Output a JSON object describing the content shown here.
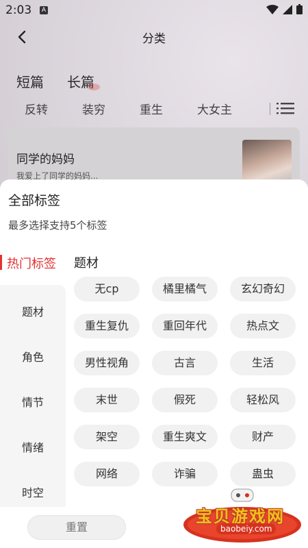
{
  "status_bar": {
    "time": "2:03",
    "app_icon_letter": "A"
  },
  "header": {
    "title": "分类"
  },
  "main_tabs": [
    {
      "label": "短篇"
    },
    {
      "label": "长篇"
    }
  ],
  "sub_tabs": [
    {
      "label": "反转"
    },
    {
      "label": "装穷"
    },
    {
      "label": "重生"
    },
    {
      "label": "大女主"
    }
  ],
  "book": {
    "title": "同学的妈妈",
    "desc": "我爱上了同学的妈妈..."
  },
  "sheet": {
    "title": "全部标签",
    "subtitle": "最多选择支持5个标签",
    "nav": {
      "active": "热门标签",
      "items": [
        {
          "label": "题材"
        },
        {
          "label": "角色"
        },
        {
          "label": "情节"
        },
        {
          "label": "情绪"
        },
        {
          "label": "时空"
        }
      ]
    },
    "section_title": "题材",
    "tags": [
      "无cp",
      "橘里橘气",
      "玄幻奇幻",
      "重生复仇",
      "重回年代",
      "热点文",
      "男性视角",
      "古言",
      "生活",
      "末世",
      "假死",
      "轻松风",
      "架空",
      "重生爽文",
      "财产",
      "网络",
      "诈骗",
      "蛊虫"
    ],
    "reset_label": "重置"
  },
  "watermark": {
    "text": "宝贝游戏网",
    "url": "baobeiy.com"
  },
  "colors": {
    "accent": "#e23232",
    "chip_bg": "#f1f1f1",
    "nav_bg": "#f5f5f5"
  }
}
